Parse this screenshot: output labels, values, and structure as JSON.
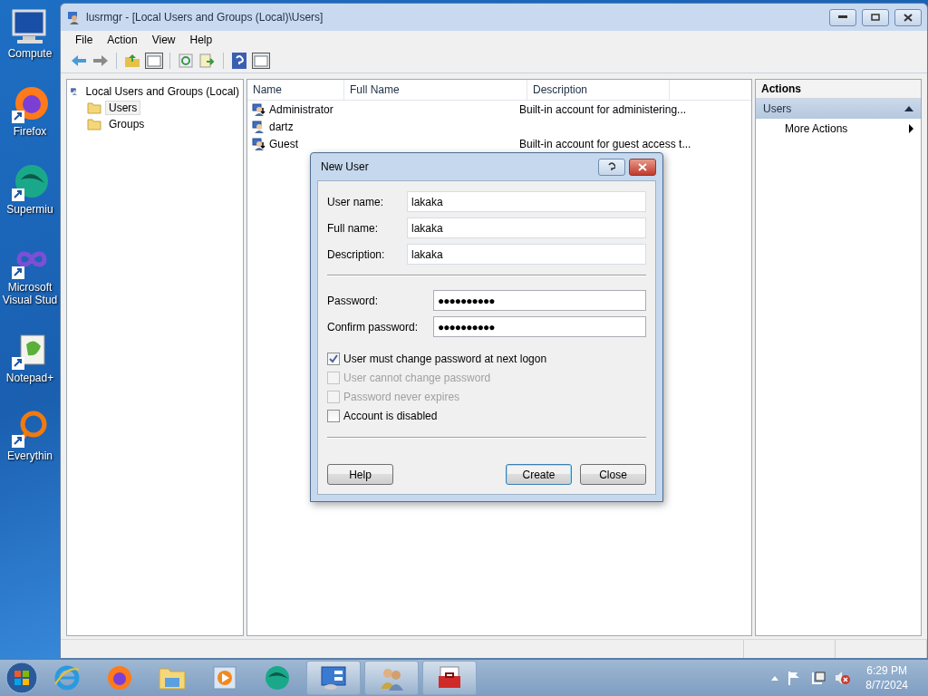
{
  "desktop_icons": [
    {
      "kind": "computer",
      "lines": [
        "Compute"
      ]
    },
    {
      "kind": "firefox",
      "lines": [
        "Firefox"
      ]
    },
    {
      "kind": "supermium",
      "lines": [
        "Supermiu"
      ]
    },
    {
      "kind": "studio",
      "lines": [
        "Microsoft",
        "Visual Stud"
      ]
    },
    {
      "kind": "notepad",
      "lines": [
        "Notepad+"
      ]
    },
    {
      "kind": "everything",
      "lines": [
        "Everythin"
      ]
    }
  ],
  "window": {
    "title": "lusrmgr - [Local Users and Groups (Local)\\Users]",
    "menu": [
      "File",
      "Action",
      "View",
      "Help"
    ],
    "tree": {
      "label": "Local Users and Groups (Local)",
      "children": [
        {
          "label": "Users",
          "selected": true
        },
        {
          "label": "Groups",
          "selected": false
        }
      ]
    },
    "list": {
      "columns": [
        "Name",
        "Full Name",
        "Description"
      ],
      "rows": [
        {
          "kind": "builtin",
          "name": "Administrator",
          "full_name": "",
          "description": "Built-in account for administering..."
        },
        {
          "kind": "user",
          "name": "dartz",
          "full_name": "",
          "description": ""
        },
        {
          "kind": "builtin",
          "name": "Guest",
          "full_name": "",
          "description": "Built-in account for guest access t..."
        }
      ]
    },
    "actions": {
      "title": "Actions",
      "section": {
        "label": "Users",
        "expanded": true,
        "items": [
          "More Actions"
        ]
      }
    }
  },
  "dialog": {
    "title": "New User",
    "fields": [
      {
        "kind": "text",
        "label": "User name:",
        "value": "lakaka"
      },
      {
        "kind": "text",
        "label": "Full name:",
        "value": "lakaka"
      },
      {
        "kind": "text",
        "label": "Description:",
        "value": "lakaka"
      },
      {
        "kind": "password",
        "label": "Password:",
        "value": "●●●●●●●●●●"
      },
      {
        "kind": "password",
        "label": "Confirm password:",
        "value": "●●●●●●●●●●"
      }
    ],
    "checkboxes": [
      {
        "label": "User must change password at next logon",
        "checked": true,
        "disabled": false
      },
      {
        "label": "User cannot change password",
        "checked": false,
        "disabled": true
      },
      {
        "label": "Password never expires",
        "checked": false,
        "disabled": true
      },
      {
        "label": "Account is disabled",
        "checked": false,
        "disabled": false
      }
    ],
    "buttons": [
      {
        "label": "Help",
        "default": false
      },
      {
        "label": "Create",
        "default": true
      },
      {
        "label": "Close",
        "default": false
      }
    ]
  },
  "taskbar": {
    "time": "6:29 PM",
    "date": "8/7/2024"
  }
}
